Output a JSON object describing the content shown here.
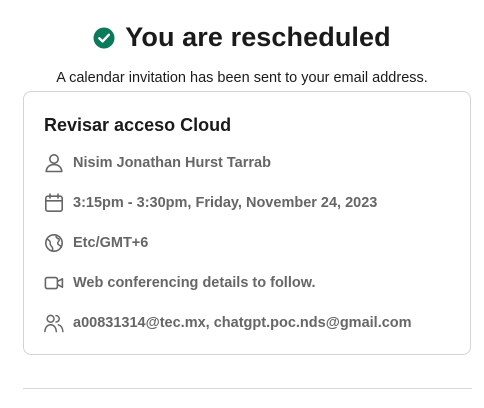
{
  "header": {
    "title": "You are rescheduled",
    "subtitle": "A calendar invitation has been sent to your email address."
  },
  "event": {
    "name": "Revisar acceso Cloud",
    "host": "Nisim Jonathan Hurst Tarrab",
    "datetime": "3:15pm - 3:30pm, Friday, November 24, 2023",
    "timezone": "Etc/GMT+6",
    "location": "Web conferencing details to follow.",
    "attendees": "a00831314@tec.mx, chatgpt.poc.nds@gmail.com"
  },
  "colors": {
    "accent": "#0a7a5a",
    "text": "#1a1a1a",
    "muted": "#666666",
    "border": "#d4d4d4"
  },
  "icons": {
    "status": "check-circle-icon",
    "host": "person-icon",
    "datetime": "calendar-icon",
    "timezone": "globe-icon",
    "location": "video-icon",
    "attendees": "people-icon"
  }
}
